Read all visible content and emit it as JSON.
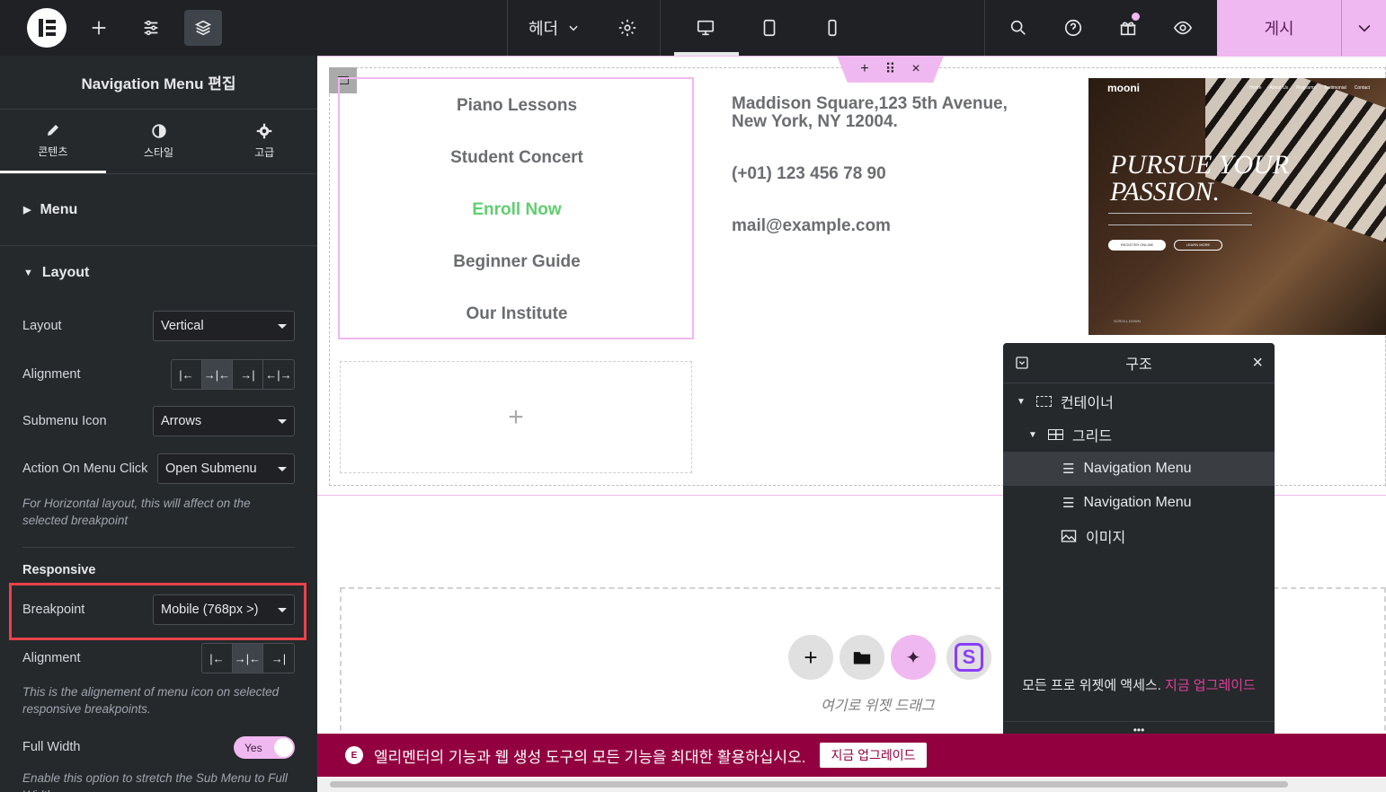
{
  "topbar": {
    "header_label": "헤더",
    "publish_label": "게시",
    "icons": [
      "elementor-logo-icon",
      "add-icon",
      "settings-sliders-icon",
      "layers-icon",
      "gear-icon",
      "desktop-icon",
      "tablet-icon",
      "mobile-icon",
      "search-icon",
      "help-icon",
      "gift-icon",
      "preview-eye-icon",
      "chevron-down-icon"
    ]
  },
  "panel": {
    "title": "Navigation Menu 편집",
    "tabs": [
      {
        "label": "콘텐츠"
      },
      {
        "label": "스타일"
      },
      {
        "label": "고급"
      }
    ],
    "sections": {
      "menu": "Menu",
      "layout": "Layout"
    },
    "layout_label": "Layout",
    "layout_value": "Vertical",
    "alignment_label": "Alignment",
    "submenu_icon_label": "Submenu Icon",
    "submenu_icon_value": "Arrows",
    "action_label": "Action On Menu Click",
    "action_value": "Open Submenu",
    "horizontal_note": "For Horizontal layout, this will affect on the selected breakpoint",
    "responsive_heading": "Responsive",
    "breakpoint_label": "Breakpoint",
    "breakpoint_value": "Mobile (768px >)",
    "alignment2_label": "Alignment",
    "alignment2_note": "This is the alignement of menu icon on selected responsive breakpoints.",
    "full_width_label": "Full Width",
    "full_width_value": "Yes",
    "full_width_note": "Enable this option to stretch the Sub Menu to Full Width."
  },
  "canvas": {
    "menu_items": [
      {
        "label": "Piano Lessons",
        "active": false
      },
      {
        "label": "Student Concert",
        "active": false
      },
      {
        "label": "Enroll Now",
        "active": true
      },
      {
        "label": "Beginner Guide",
        "active": false
      },
      {
        "label": "Our Institute",
        "active": false
      }
    ],
    "address": "Maddison Square,123 5th Avenue, New York, NY 12004.",
    "phone": "(+01) 123 456 78 90",
    "email": "mail@example.com",
    "preview": {
      "brand": "mooni",
      "nav": [
        "Home",
        "About Us",
        "Programs",
        "Testimonial",
        "Contact"
      ],
      "headline": "PURSUE YOUR PASSION.",
      "btn1": "REGISTER ONLINE",
      "btn2": "LEARN MORE",
      "scroll": "SCROLL DOWN"
    },
    "drop_hint": "여기로 위젯 드래그"
  },
  "structure": {
    "title": "구조",
    "items": [
      {
        "label": "컨테이너",
        "icon": "container-icon"
      },
      {
        "label": "그리드",
        "icon": "grid-icon"
      },
      {
        "label": "Navigation Menu",
        "icon": "menu-lines-icon"
      },
      {
        "label": "Navigation Menu",
        "icon": "menu-lines-icon"
      },
      {
        "label": "이미지",
        "icon": "image-icon"
      }
    ],
    "promo_text": "모든 프로 위젯에 액세스.",
    "promo_link": "지금 업그레이드"
  },
  "promo_bar": {
    "text": "엘리멘터의 기능과 웹 생성 도구의 모든 기능을 최대한 활용하십시오.",
    "button": "지금 업그레이드"
  },
  "colors": {
    "accent": "#f0b8f0",
    "highlight": "#e8424a",
    "active_green": "#61ce70",
    "promo_bg": "#93003f"
  }
}
